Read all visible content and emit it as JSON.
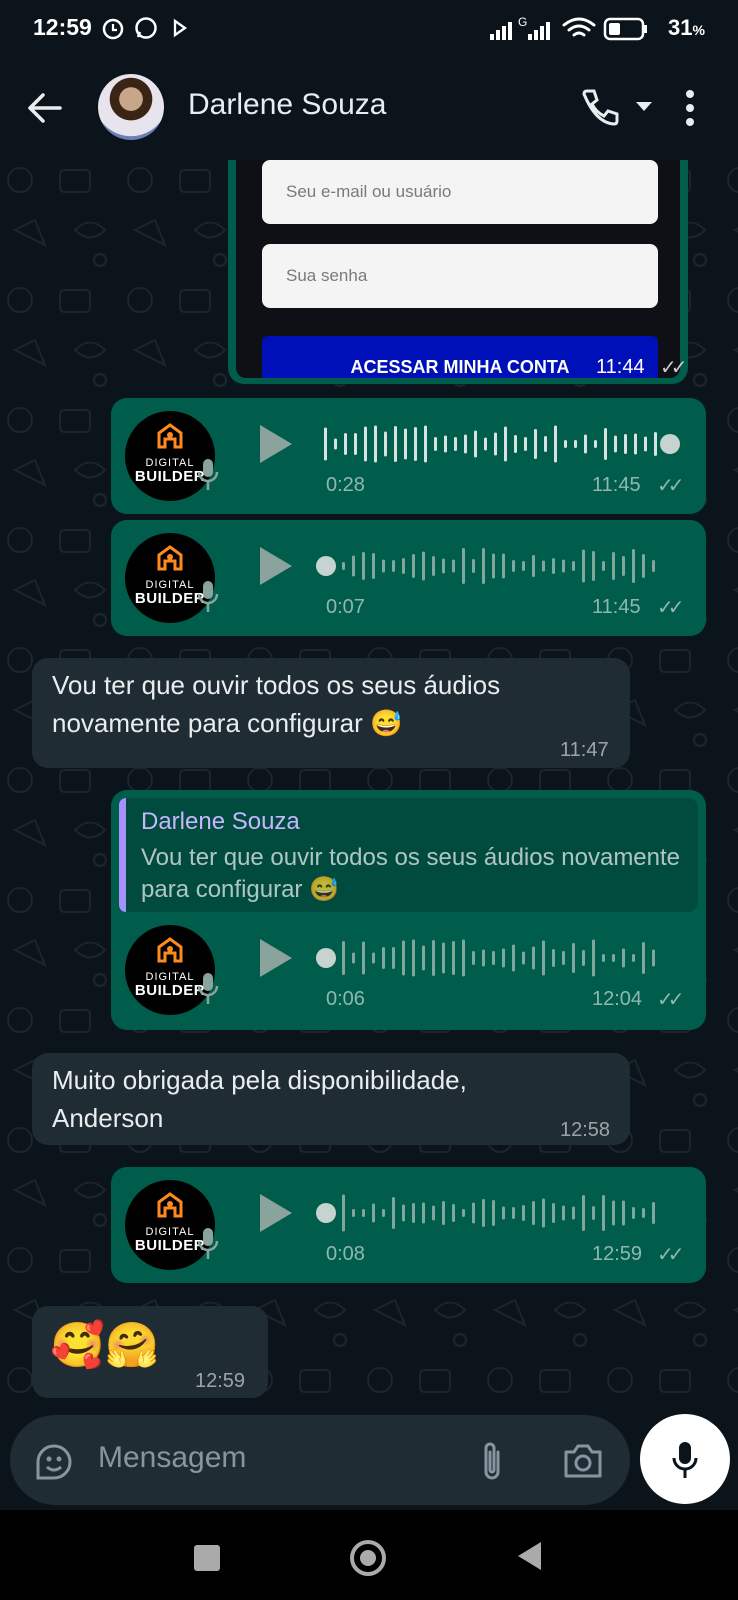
{
  "status_bar": {
    "time": "12:59",
    "network_label": "G",
    "battery": "31",
    "battery_unit": "%"
  },
  "header": {
    "contact_name": "Darlene Souza"
  },
  "image_message": {
    "email_placeholder": "Seu e-mail ou usuário",
    "password_placeholder": "Sua senha",
    "button_label": "ACESSAR MINHA CONTA",
    "time": "11:44"
  },
  "logo": {
    "line1": "DIGITAL",
    "line2": "BUILDER"
  },
  "messages": [
    {
      "kind": "audio",
      "direction": "out",
      "duration": "0:28",
      "time": "11:45",
      "progress": 1.0
    },
    {
      "kind": "audio",
      "direction": "out",
      "duration": "0:07",
      "time": "11:45",
      "progress": 0.0
    },
    {
      "kind": "text",
      "direction": "in",
      "text": "Vou ter que ouvir todos os seus áudios novamente para configurar 😅",
      "time": "11:47"
    },
    {
      "kind": "audio_reply",
      "direction": "out",
      "quoted_author": "Darlene Souza",
      "quoted_text": "Vou ter que ouvir todos os seus áudios novamente para configurar 😅",
      "duration": "0:06",
      "time": "12:04",
      "progress": 0.0
    },
    {
      "kind": "text",
      "direction": "in",
      "text": "Muito obrigada pela disponibilidade, Anderson",
      "time": "12:58"
    },
    {
      "kind": "audio",
      "direction": "out",
      "duration": "0:08",
      "time": "12:59",
      "progress": 0.0
    },
    {
      "kind": "text",
      "direction": "in",
      "text": "🥰🤗",
      "time": "12:59"
    }
  ],
  "composer": {
    "placeholder": "Mensagem"
  },
  "colors": {
    "background": "#0b141a",
    "outgoing_bubble": "#005c4b",
    "incoming_bubble": "#202c33",
    "quote_bar": "#a791ff",
    "quote_author": "#c5b6ff"
  },
  "icons": [
    "back-arrow-icon",
    "phone-icon",
    "dropdown-icon",
    "more-vert-icon",
    "play-icon",
    "mic-icon",
    "double-check-icon",
    "sticker-icon",
    "attach-icon",
    "camera-icon",
    "square-nav-icon",
    "circle-nav-icon",
    "triangle-nav-icon"
  ]
}
